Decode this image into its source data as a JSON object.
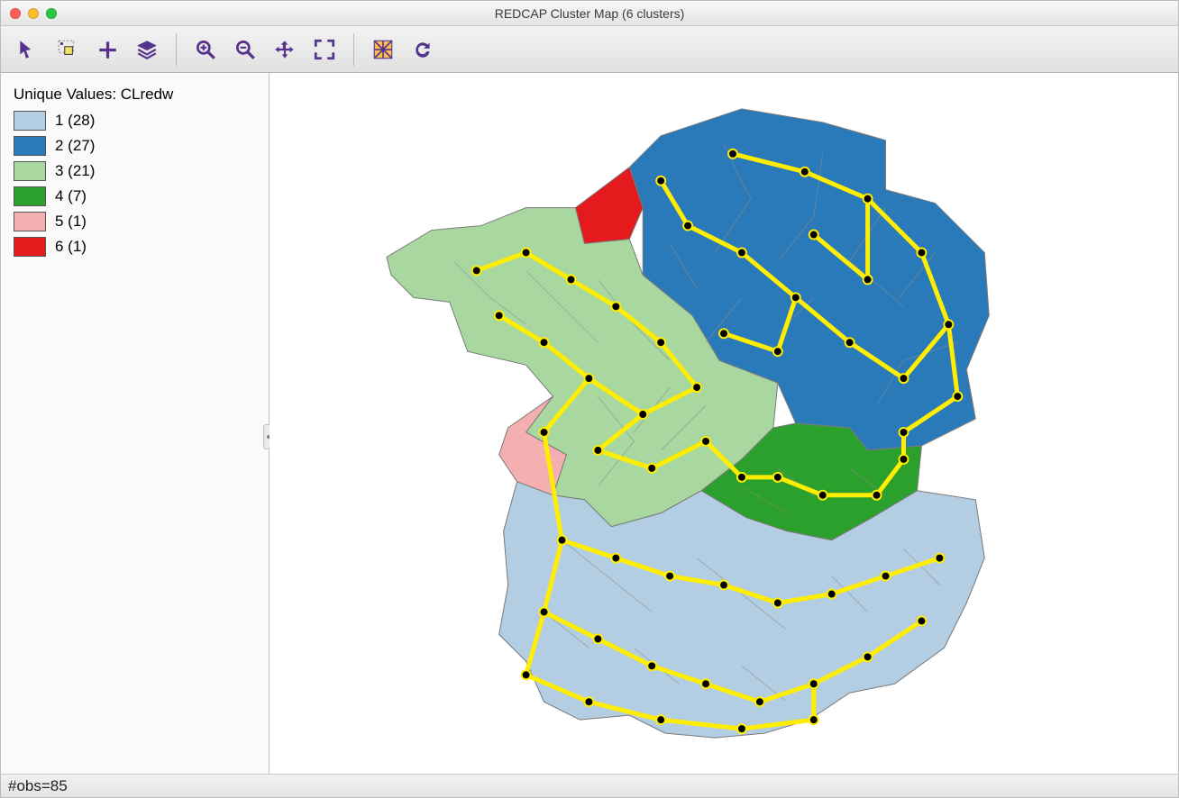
{
  "window": {
    "title": "REDCAP Cluster Map (6 clusters)"
  },
  "toolbar": {
    "icons": [
      "pointer",
      "select-rect",
      "add",
      "layers",
      "zoom-in",
      "zoom-out",
      "pan",
      "full-extent",
      "intersect",
      "refresh"
    ]
  },
  "legend": {
    "title": "Unique Values: CLredw",
    "items": [
      {
        "color": "#b3cde3",
        "label": "1 (28)",
        "value": 1,
        "count": 28
      },
      {
        "color": "#2a7ab9",
        "label": "2 (27)",
        "value": 2,
        "count": 27
      },
      {
        "color": "#a8d8a0",
        "label": "3 (21)",
        "value": 3,
        "count": 21
      },
      {
        "color": "#2ca02c",
        "label": "4 (7)",
        "value": 4,
        "count": 7
      },
      {
        "color": "#f4b0b0",
        "label": "5 (1)",
        "value": 5,
        "count": 1
      },
      {
        "color": "#e41a1c",
        "label": "6 (1)",
        "value": 6,
        "count": 1
      }
    ]
  },
  "status": {
    "obs_text": "#obs=85",
    "obs": 85
  },
  "map": {
    "description": "France départements choropleth with spanning-tree graph overlay",
    "clusters": 6,
    "tree_color": "#ffee00",
    "node_fill": "#000"
  }
}
